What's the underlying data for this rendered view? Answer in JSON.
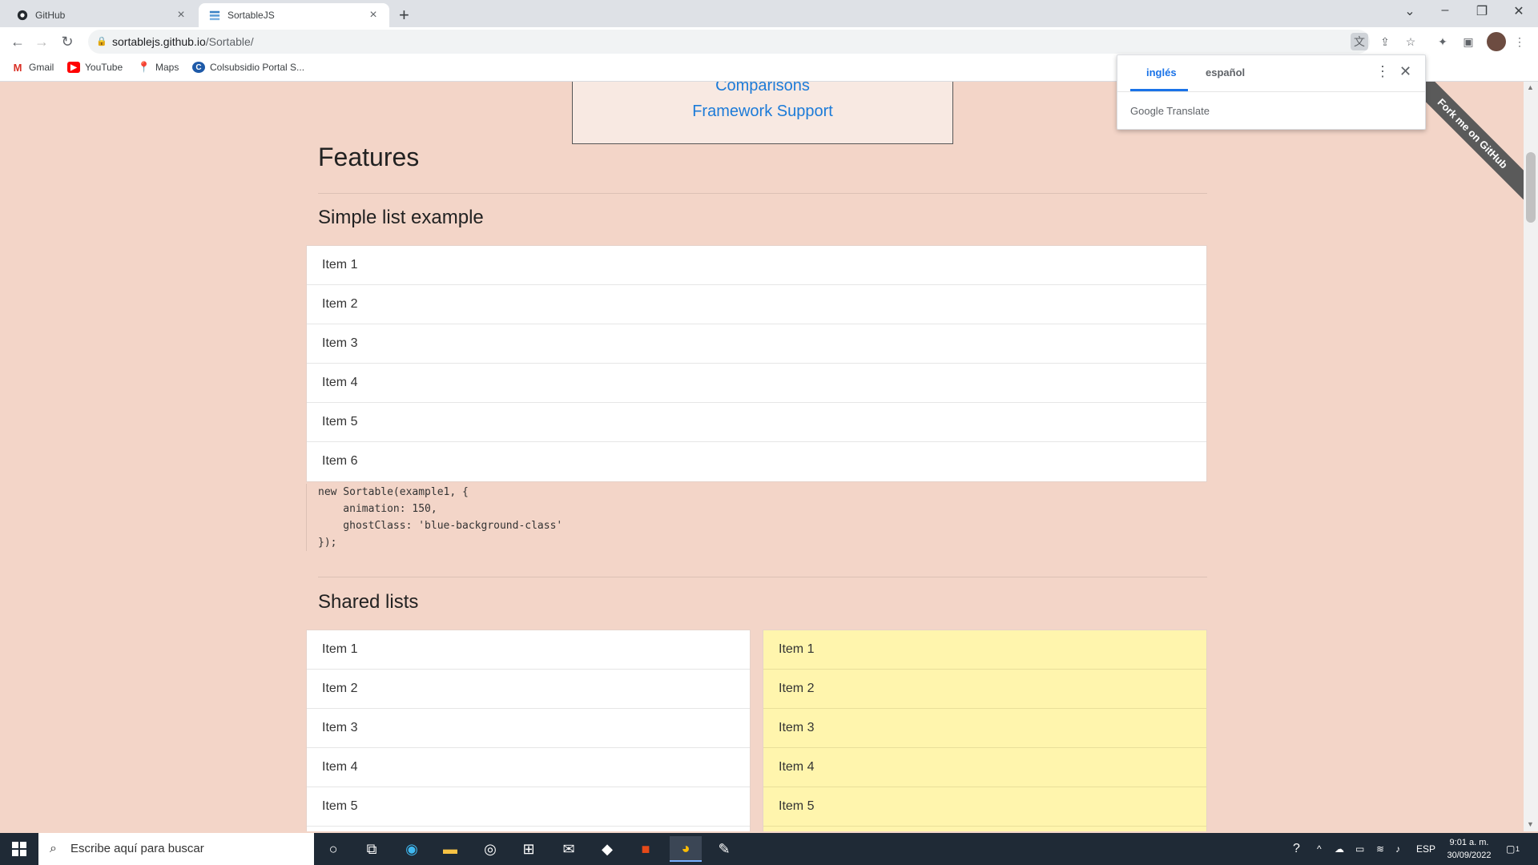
{
  "browser": {
    "tabs": [
      {
        "label": "GitHub",
        "close": "×"
      },
      {
        "label": "SortableJS",
        "close": "×"
      }
    ],
    "new_tab": "+",
    "url_host": "sortablejs.github.io",
    "url_path": "/Sortable/",
    "bookmarks": [
      "Gmail",
      "YouTube",
      "Maps",
      "Colsubsidio Portal S..."
    ]
  },
  "translate_popup": {
    "tab_selected": "inglés",
    "tab_other": "español",
    "brand": "Google Translate"
  },
  "toc": {
    "links": [
      "Comparisons",
      "Framework Support"
    ]
  },
  "page": {
    "title": "Features",
    "simple_list": {
      "heading": "Simple list example",
      "items": [
        "Item 1",
        "Item 2",
        "Item 3",
        "Item 4",
        "Item 5",
        "Item 6"
      ],
      "code": "new Sortable(example1, {\n    animation: 150,\n    ghostClass: 'blue-background-class'\n});"
    },
    "shared_lists": {
      "heading": "Shared lists",
      "left_items": [
        "Item 1",
        "Item 2",
        "Item 3",
        "Item 4",
        "Item 5"
      ],
      "right_items": [
        "Item 1",
        "Item 2",
        "Item 3",
        "Item 4",
        "Item 5"
      ]
    },
    "ribbon": "Fork me on GitHub"
  },
  "taskbar": {
    "search_placeholder": "Escribe aquí para buscar",
    "language": "ESP",
    "time": "9:01 a. m.",
    "date": "30/09/2022",
    "notification_count": "1"
  },
  "colors": {
    "page_bg": "#f3d5c8",
    "link": "#1c7bd8",
    "yellow_list": "#fff5ad"
  }
}
